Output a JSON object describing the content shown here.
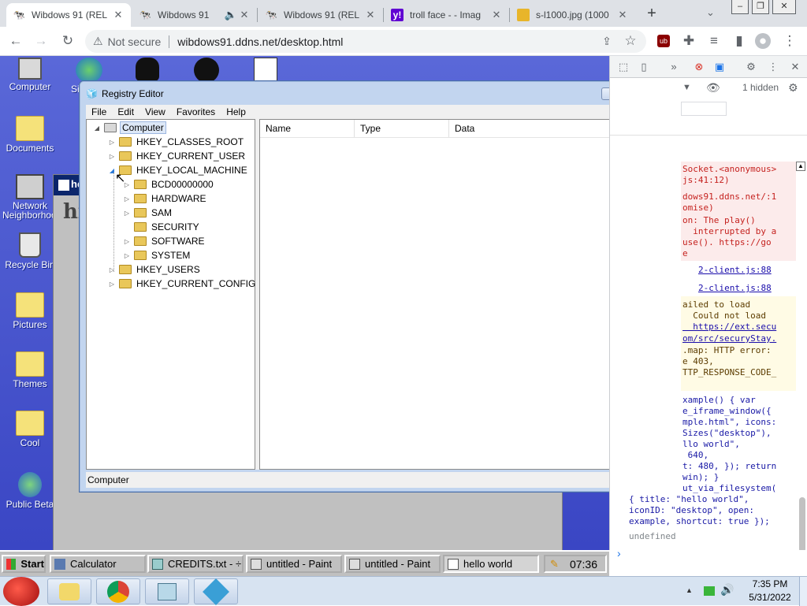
{
  "browser": {
    "tabs": [
      {
        "title": "Wibdows 91 (REL",
        "active": true
      },
      {
        "title": "Wibdows 91"
      },
      {
        "title": "Wibdows 91 (REL"
      },
      {
        "title": "troll face - - Imag"
      },
      {
        "title": "s-l1000.jpg (1000"
      }
    ],
    "new_tab": "+",
    "url_warning": "Not secure",
    "url": "wibdows91.ddns.net/desktop.html"
  },
  "desktop": {
    "icons": [
      {
        "label": "Computer"
      },
      {
        "label": "Documents"
      },
      {
        "label": "Network Neighborhood"
      },
      {
        "label": "Recycle Bin"
      },
      {
        "label": "Pictures"
      },
      {
        "label": "Themes"
      },
      {
        "label": "Cool"
      },
      {
        "label": "Public Beta"
      }
    ],
    "partial_icon_label": "Si",
    "back_window_text": "hi",
    "back_window_title": "he"
  },
  "registry": {
    "title": "Registry Editor",
    "menus": [
      "File",
      "Edit",
      "View",
      "Favorites",
      "Help"
    ],
    "tree": {
      "root": "Computer",
      "nodes": [
        {
          "label": "HKEY_CLASSES_ROOT",
          "level": 1
        },
        {
          "label": "HKEY_CURRENT_USER",
          "level": 1
        },
        {
          "label": "HKEY_LOCAL_MACHINE",
          "level": 1
        },
        {
          "label": "BCD00000000",
          "level": 2
        },
        {
          "label": "HARDWARE",
          "level": 2
        },
        {
          "label": "SAM",
          "level": 2
        },
        {
          "label": "SECURITY",
          "level": 2
        },
        {
          "label": "SOFTWARE",
          "level": 2
        },
        {
          "label": "SYSTEM",
          "level": 2
        },
        {
          "label": "HKEY_USERS",
          "level": 1
        },
        {
          "label": "HKEY_CURRENT_CONFIG",
          "level": 1
        }
      ]
    },
    "columns": [
      "Name",
      "Type",
      "Data"
    ],
    "status": "Computer"
  },
  "devtools": {
    "hidden_label": "1 hidden",
    "console": [
      {
        "text": "Socket.<anonymous>",
        "cls": "red"
      },
      {
        "text": "js:41:12)",
        "cls": "red"
      },
      {
        "text": "dows91.ddns.net/:1",
        "cls": "red"
      },
      {
        "text": "omise)",
        "cls": "red"
      },
      {
        "text": "on: The play()",
        "cls": "red"
      },
      {
        "text": "  interrupted by a",
        "cls": "red"
      },
      {
        "text": "use(). https://go",
        "cls": "red"
      },
      {
        "text": "e",
        "cls": "red"
      }
    ],
    "src1": "2-client.js:88",
    "src2": "2-client.js:88",
    "warn": [
      "ailed to load",
      "  Could not load",
      "  https://ext.secu",
      "om/src/securyStay.",
      ".map: HTTP error:",
      "e 403,",
      "TTP_RESPONSE_CODE_"
    ],
    "code": [
      "xample() { var",
      "e_iframe_window({",
      "mple.html\", icons:",
      "Sizes(\"desktop\"),",
      "llo world\",",
      " 640,",
      "t: 480, }); return",
      "win); }",
      "ut_via_filesystem(",
      "{ title: \"hello world\",",
      "iconID: \"desktop\", open:",
      "example, shortcut: true });"
    ],
    "result": "undefined",
    "prompt": "›"
  },
  "taskbar91": {
    "start": "Start",
    "buttons": [
      "Calculator",
      "CREDITS.txt - ÷",
      "untitled - Paint",
      "untitled - Paint",
      "hello world"
    ],
    "clock": "07:36"
  },
  "host": {
    "time": "7:35 PM",
    "date": "5/31/2022"
  }
}
